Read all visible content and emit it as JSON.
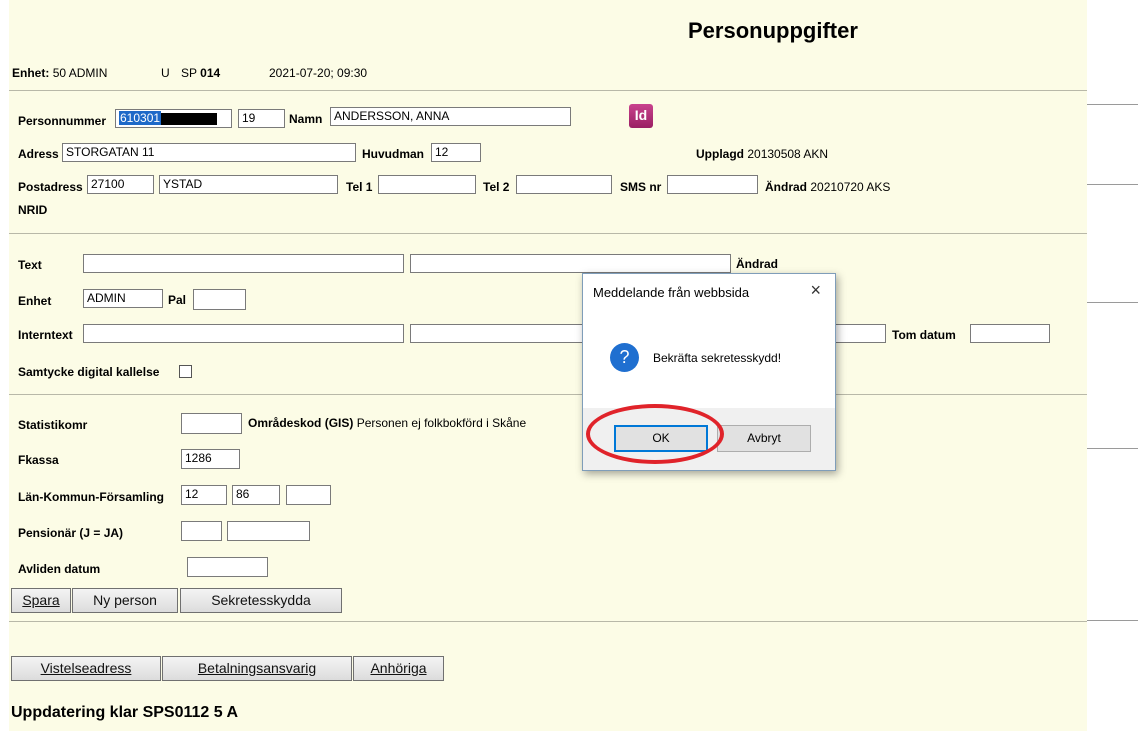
{
  "header": {
    "title": "Personuppgifter",
    "enhet_label": "Enhet:",
    "enhet_value": "50 ADMIN",
    "u": "U",
    "sp_label": "SP",
    "sp_value": "014",
    "datetime": "2021-07-20; 09:30"
  },
  "person": {
    "personnummer_label": "Personnummer",
    "personnummer_value": "610301",
    "century": "19",
    "namn_label": "Namn",
    "namn_value": "ANDERSSON, ANNA",
    "icon": "id-card-icon",
    "adress_label": "Adress",
    "adress_value": "STORGATAN 11",
    "huvudman_label": "Huvudman",
    "huvudman_value": "12",
    "upplagd_label": "Upplagd",
    "upplagd_value": "20130508 AKN",
    "postadress_label": "Postadress",
    "postnr_value": "27100",
    "ort_value": "YSTAD",
    "tel1_label": "Tel 1",
    "tel1_value": "",
    "tel2_label": "Tel 2",
    "tel2_value": "",
    "sms_label": "SMS nr",
    "sms_value": "",
    "andrad_label": "Ändrad",
    "andrad_value": "20210720 AKS",
    "nrid_label": "NRID"
  },
  "notes": {
    "text_label": "Text",
    "andrad_label": "Ändrad",
    "enhet_label": "Enhet",
    "enhet_value": "ADMIN",
    "pal_label": "Pal",
    "pal_value": "",
    "internt_label": "Interntext",
    "tom_datum_label": "Tom datum",
    "samtycke_label": "Samtycke digital kallelse"
  },
  "stats": {
    "statistikomr_label": "Statistikomr",
    "statistikomr_value": "",
    "omradeskod_label": "Områdeskod (GIS)",
    "omradeskod_value": "Personen ej folkbokförd i Skåne",
    "fkassa_label": "Fkassa",
    "fkassa_value": "1286",
    "lkf_label": "Län-Kommun-Församling",
    "lan_value": "12",
    "kommun_value": "86",
    "forsamling_value": "",
    "pensionar_label": "Pensionär (J = JA)",
    "avliden_label": "Avliden datum"
  },
  "buttons": {
    "spara": "Spara",
    "ny_person": "Ny person",
    "sekretess": "Sekretesskydda",
    "vistelse": "Vistelseadress",
    "betalning": "Betalningsansvarig",
    "anhoriga": "Anhöriga"
  },
  "status": "Uppdatering klar SPS0112 5 A",
  "dialog": {
    "title": "Meddelande från webbsida",
    "close": "×",
    "message": "Bekräfta sekretesskydd!",
    "icon": "question-icon",
    "ok": "OK",
    "cancel": "Avbryt",
    "highlight_color": "#e0232a"
  }
}
